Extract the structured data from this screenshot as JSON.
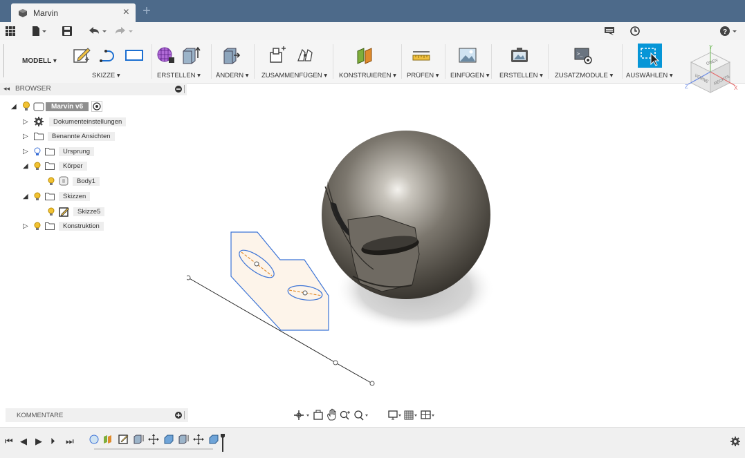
{
  "window": {
    "tab_title": "Marvin",
    "close_glyph": "×",
    "new_tab_glyph": "+"
  },
  "quick_access": {
    "icons": [
      "apps-grid-icon",
      "file-icon",
      "save-icon",
      "undo-icon",
      "redo-icon"
    ],
    "right_icons": [
      "comments-icon",
      "history-clock-icon",
      "help-icon"
    ]
  },
  "ribbon": {
    "workspace": "MODELL ▾",
    "groups": [
      {
        "label": "SKIZZE ▾"
      },
      {
        "label": "ERSTELLEN ▾"
      },
      {
        "label": "ÄNDERN ▾"
      },
      {
        "label": "ZUSAMMENFÜGEN ▾"
      },
      {
        "label": "KONSTRUIEREN ▾"
      },
      {
        "label": "PRÜFEN ▾"
      },
      {
        "label": "EINFÜGEN ▾"
      },
      {
        "label": "ERSTELLEN ▾"
      },
      {
        "label": "ZUSATZMODULE ▾"
      },
      {
        "label": "AUSWÄHLEN ▾"
      }
    ]
  },
  "viewcube": {
    "top": "OBEN",
    "front": "VORNE",
    "right": "RECHTS",
    "axis_x": "X",
    "axis_y": "Y",
    "axis_z": "Z"
  },
  "browser": {
    "title": "BROWSER",
    "root": "Marvin v6",
    "items": [
      {
        "label": "Dokumenteinstellungen"
      },
      {
        "label": "Benannte Ansichten"
      },
      {
        "label": "Ursprung"
      },
      {
        "label": "Körper"
      },
      {
        "label": "Body1"
      },
      {
        "label": "Skizzen"
      },
      {
        "label": "Skizze5"
      },
      {
        "label": "Konstruktion"
      }
    ]
  },
  "comments": {
    "title": "KOMMENTARE"
  },
  "colors": {
    "titlebar": "#4d6a8a",
    "accent": "#0696d7",
    "sketch_blue": "#3b73d6"
  }
}
